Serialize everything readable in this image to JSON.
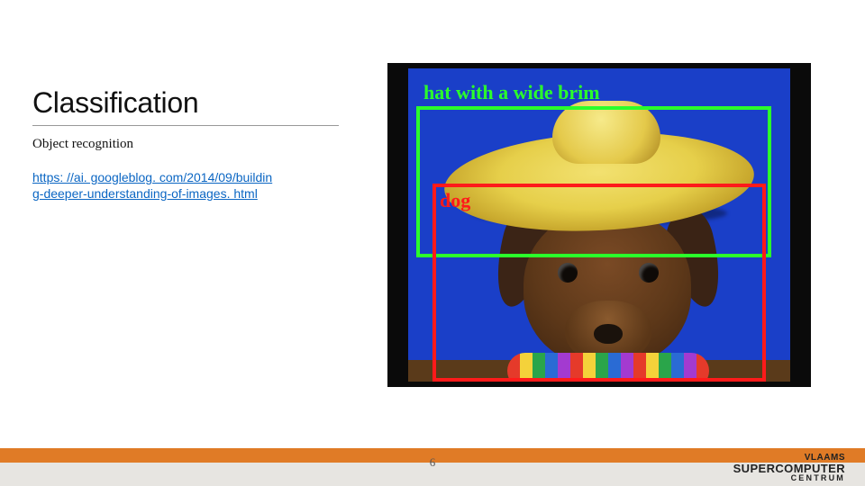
{
  "title": "Classification",
  "subtitle": "Object recognition",
  "link": {
    "line1": "https: //ai. googleblog. com/2014/09/buildin",
    "line2": "g-deeper-understanding-of-images. html"
  },
  "detections": {
    "hat_label": "hat with a wide brim",
    "dog_label": "dog"
  },
  "page_number": "6",
  "logo": {
    "line1": "VLAAMS",
    "line2": "SUPERCOMPUTER",
    "line3": "CENTRUM"
  },
  "colors": {
    "accent": "#e07b26",
    "link": "#0b66c3",
    "bbox_green": "#2bff2b",
    "bbox_red": "#ff1a1a"
  }
}
